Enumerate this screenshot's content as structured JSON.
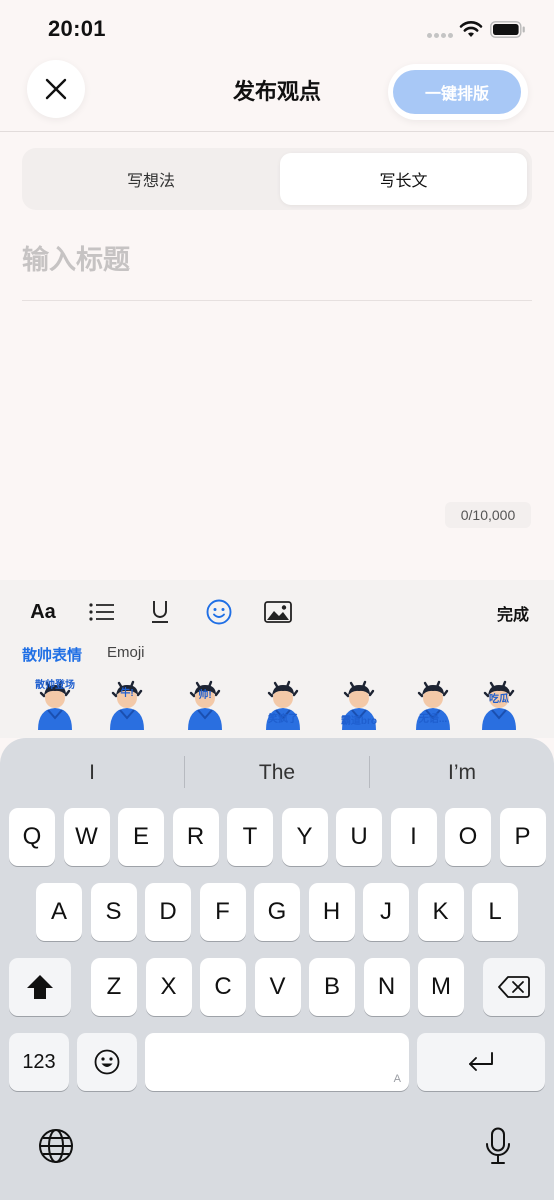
{
  "status": {
    "time": "20:01"
  },
  "header": {
    "title": "发布观点",
    "format_label": "一键排版"
  },
  "tabs": [
    {
      "label": "写想法"
    },
    {
      "label": "写长文"
    }
  ],
  "editor": {
    "title_placeholder": "输入标题",
    "word_count": "0/10,000"
  },
  "toolbar": {
    "font_label": "Aa",
    "done_label": "完成",
    "icons": [
      "list-icon",
      "underline-icon",
      "emoji-icon",
      "image-icon"
    ],
    "accent_color": "#1f6fe5"
  },
  "sticker_tabs": [
    {
      "label": "散帅表情"
    },
    {
      "label": "Emoji"
    }
  ],
  "stickers": [
    {
      "caption": "散帅登场"
    },
    {
      "caption": "牛!"
    },
    {
      "caption": "帅!"
    },
    {
      "caption": "笑疯了"
    },
    {
      "caption": "霸道bro"
    },
    {
      "caption": "无语..."
    },
    {
      "caption": "吃瓜"
    }
  ],
  "keyboard": {
    "suggestions": [
      "I",
      "The",
      "I’m"
    ],
    "row1": [
      "Q",
      "W",
      "E",
      "R",
      "T",
      "Y",
      "U",
      "I",
      "O",
      "P"
    ],
    "row2": [
      "A",
      "S",
      "D",
      "F",
      "G",
      "H",
      "J",
      "K",
      "L"
    ],
    "row3": [
      "Z",
      "X",
      "C",
      "V",
      "B",
      "N",
      "M"
    ],
    "numbers_label": "123",
    "space_hint": "A"
  }
}
